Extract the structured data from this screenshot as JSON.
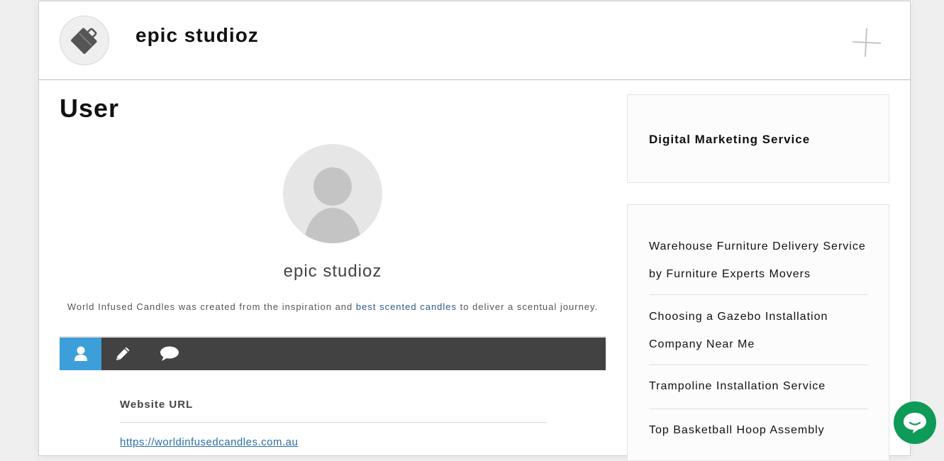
{
  "site": {
    "title": "epic studioz"
  },
  "main": {
    "page_heading": "User",
    "user": {
      "name": "epic studioz",
      "bio_before": "World Infused Candles was created from the inspiration and",
      "bio_link": "best scented candles",
      "bio_after": "to deliver a scentual journey."
    },
    "tabs": [
      {
        "icon": "user-icon",
        "active": true
      },
      {
        "icon": "pencil-icon",
        "active": false
      },
      {
        "icon": "comment-icon",
        "active": false
      }
    ],
    "fields": [
      {
        "label": "Website URL",
        "value": "https://worldinfusedcandles.com.au"
      }
    ]
  },
  "sidebar": {
    "widget_title": "Digital Marketing Service",
    "posts": [
      "Warehouse Furniture Delivery Service by Furniture Experts Movers",
      "Choosing a Gazebo Installation Company Near Me",
      "Trampoline Installation Service",
      "Top Basketball Hoop Assembly"
    ]
  },
  "colors": {
    "accent": "#3d9fd9",
    "tab_bar": "#424242",
    "chat": "#0e9a57",
    "link": "#2a5a8a"
  }
}
